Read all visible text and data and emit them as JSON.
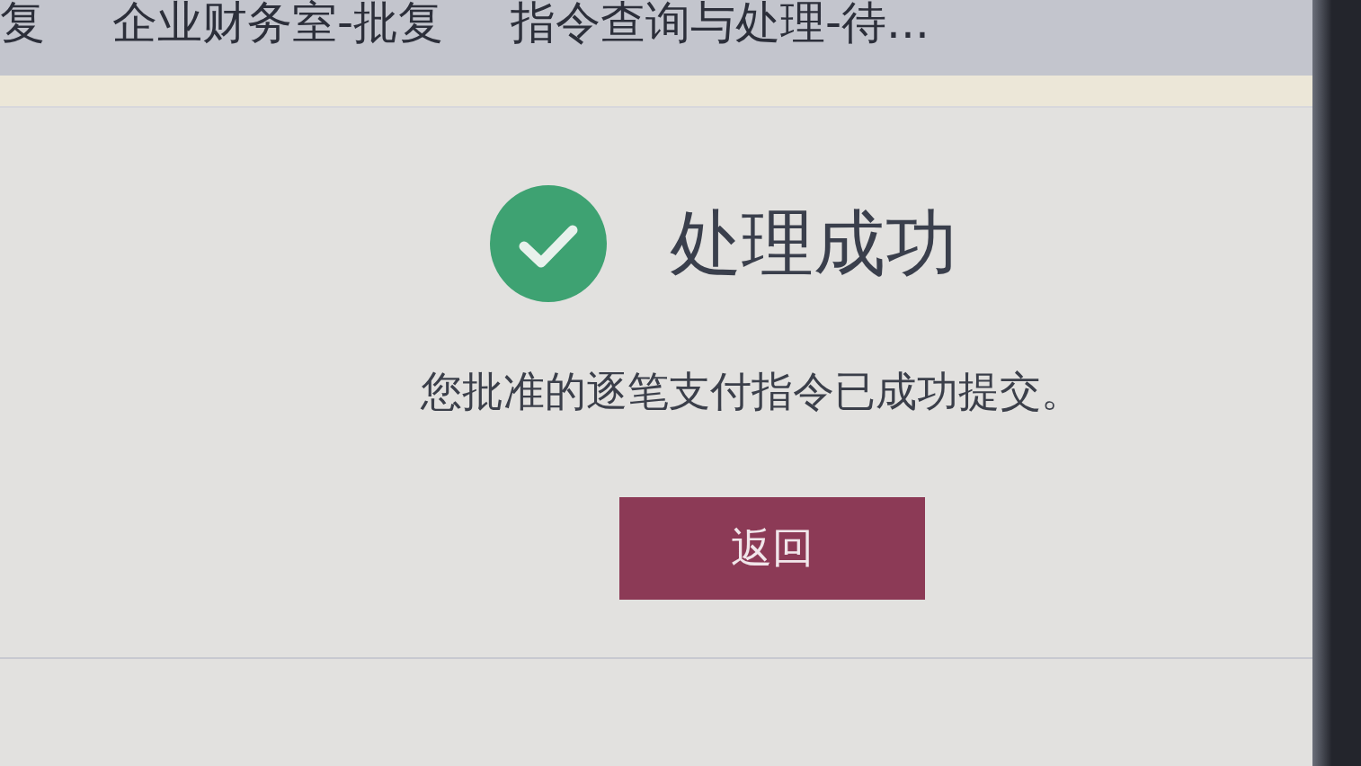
{
  "tabs": [
    {
      "label": "复"
    },
    {
      "label": "企业财务室-批复"
    },
    {
      "label": "指令查询与处理-待..."
    }
  ],
  "result": {
    "kind": "success",
    "title": "处理成功",
    "message": "您批准的逐笔支付指令已成功提交。"
  },
  "buttons": [
    {
      "label": "返回",
      "kind": "primary"
    }
  ]
}
